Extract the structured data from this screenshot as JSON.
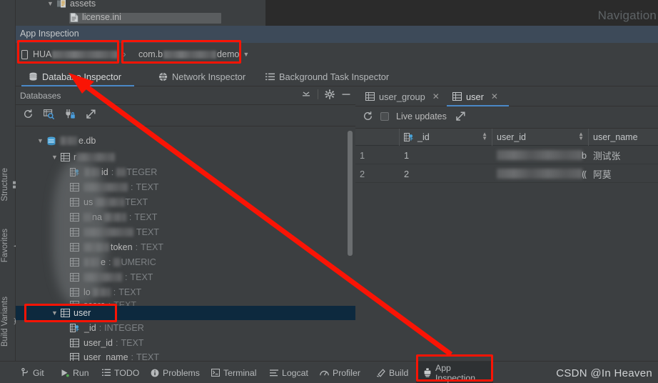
{
  "editor": {
    "project_tree": [
      {
        "label": "assets",
        "icon": "folder-assets-icon",
        "indent": 44,
        "chevron": "∨"
      },
      {
        "label": "license.ini",
        "icon": "file-ini-icon",
        "indent": 76,
        "chevron": ""
      }
    ],
    "navigation_label": "Navigation"
  },
  "app_inspection": {
    "window_title": "App Inspection",
    "device_selector": {
      "prefix": "HUA",
      "redacted": true,
      "icon": "device-phone-icon"
    },
    "process_selector": {
      "prefix": "com.b",
      "suffix": "demo",
      "redacted": true,
      "caret": "⌄"
    },
    "tabs": [
      {
        "label": "Database Inspector",
        "icon": "database-icon",
        "active": true
      },
      {
        "label": "Network Inspector",
        "icon": "globe-icon",
        "active": false
      },
      {
        "label": "Background Task Inspector",
        "icon": "list-icon",
        "active": false
      }
    ]
  },
  "databases_panel": {
    "title": "Databases",
    "header_actions": [
      "collapse-all-icon",
      "settings-gear-icon",
      "minimize-icon"
    ],
    "toolbar_icons": [
      "refresh-icon",
      "run-query-icon",
      "keep-connection-open-icon",
      "export-icon"
    ],
    "tree": [
      {
        "label": "e.db",
        "type": "",
        "kind": "database",
        "indent": 28,
        "chevron": "∨",
        "redacted_before": 26
      },
      {
        "label": "",
        "type": "",
        "kind": "table",
        "indent": 48,
        "chevron": "∨",
        "prefix": "r",
        "redacted_width": 50
      },
      {
        "label": "id",
        "type": "INTEGER",
        "kind": "pk-column",
        "indent": 76,
        "chevron": "",
        "redacted": true
      },
      {
        "label": "",
        "type": "TEXT",
        "kind": "column",
        "indent": 76,
        "chevron": "",
        "redacted": true
      },
      {
        "label": "us",
        "type": "TEXT",
        "kind": "column",
        "indent": 76,
        "chevron": "",
        "redacted": true
      },
      {
        "label": "na",
        "type": "TEXT",
        "kind": "column",
        "indent": 76,
        "chevron": "",
        "redacted": true
      },
      {
        "label": "",
        "type": "TEXT",
        "kind": "column",
        "indent": 76,
        "chevron": "",
        "redacted": true
      },
      {
        "label": "token",
        "type": "TEXT",
        "kind": "column",
        "indent": 76,
        "chevron": "",
        "redacted": true
      },
      {
        "label": "e",
        "type": "NUMERIC",
        "kind": "column",
        "indent": 76,
        "chevron": "",
        "redacted": true
      },
      {
        "label": "",
        "type": "TEXT",
        "kind": "column",
        "indent": 76,
        "chevron": "",
        "redacted": true
      },
      {
        "label": "lo",
        "type": "TEXT",
        "kind": "column",
        "indent": 76,
        "chevron": "",
        "redacted": true
      },
      {
        "label": "score",
        "type": "TEXT",
        "kind": "column",
        "indent": 76,
        "chevron": "",
        "redacted": true
      },
      {
        "label": "user",
        "type": "",
        "kind": "table",
        "indent": 48,
        "chevron": "∨",
        "selected": true
      },
      {
        "label": "_id",
        "type": "INTEGER",
        "kind": "pk-column",
        "indent": 76,
        "chevron": ""
      },
      {
        "label": "user_id",
        "type": "TEXT",
        "kind": "column",
        "indent": 76,
        "chevron": ""
      },
      {
        "label": "user_name",
        "type": "TEXT",
        "kind": "column",
        "indent": 76,
        "chevron": ""
      }
    ]
  },
  "data_panel": {
    "tabs": [
      {
        "label": "user_group",
        "icon": "table-icon",
        "active": false,
        "close": "×"
      },
      {
        "label": "user",
        "icon": "table-icon",
        "active": true,
        "close": "×"
      }
    ],
    "toolbar": {
      "refresh_icon": "refresh-icon",
      "live_updates_label": "Live updates",
      "live_updates_checked": false,
      "export_icon": "export-icon"
    },
    "columns": [
      "",
      "_id",
      "user_id",
      "user_name"
    ],
    "rows": [
      {
        "index": "1",
        "_id": "1",
        "user_id": "",
        "user_id_tail": "b",
        "user_name": "测试张",
        "user_id_redacted": true
      },
      {
        "index": "2",
        "_id": "2",
        "user_id": "",
        "user_id_tail": "⸨",
        "user_name": "阿莫",
        "user_id_redacted": true
      }
    ]
  },
  "tool_windows_left": [
    "Structure",
    "Favorites",
    "Build Variants"
  ],
  "status_bar": {
    "buttons": [
      {
        "label": "Git",
        "icon": "git-branch-icon"
      },
      {
        "label": "Run",
        "icon": "run-play-icon"
      },
      {
        "label": "TODO",
        "icon": "todo-list-icon"
      },
      {
        "label": "Problems",
        "icon": "problems-warning-icon"
      },
      {
        "label": "Terminal",
        "icon": "terminal-icon"
      },
      {
        "label": "Logcat",
        "icon": "logcat-icon"
      },
      {
        "label": "Profiler",
        "icon": "profiler-icon"
      },
      {
        "label": "Build",
        "icon": "build-hammer-icon"
      },
      {
        "label": "App Inspection",
        "icon": "app-inspection-icon",
        "active": true
      }
    ],
    "watermark": "CSDN @In  Heaven"
  },
  "annotations": {
    "accent_color": "#fa1405",
    "boxes": [
      "device-selector-box",
      "process-selector-box",
      "user-table-row-box",
      "app-inspection-button-box"
    ],
    "arrow": {
      "from": "app-inspection-status-button",
      "to": "database-inspector-tab"
    }
  }
}
